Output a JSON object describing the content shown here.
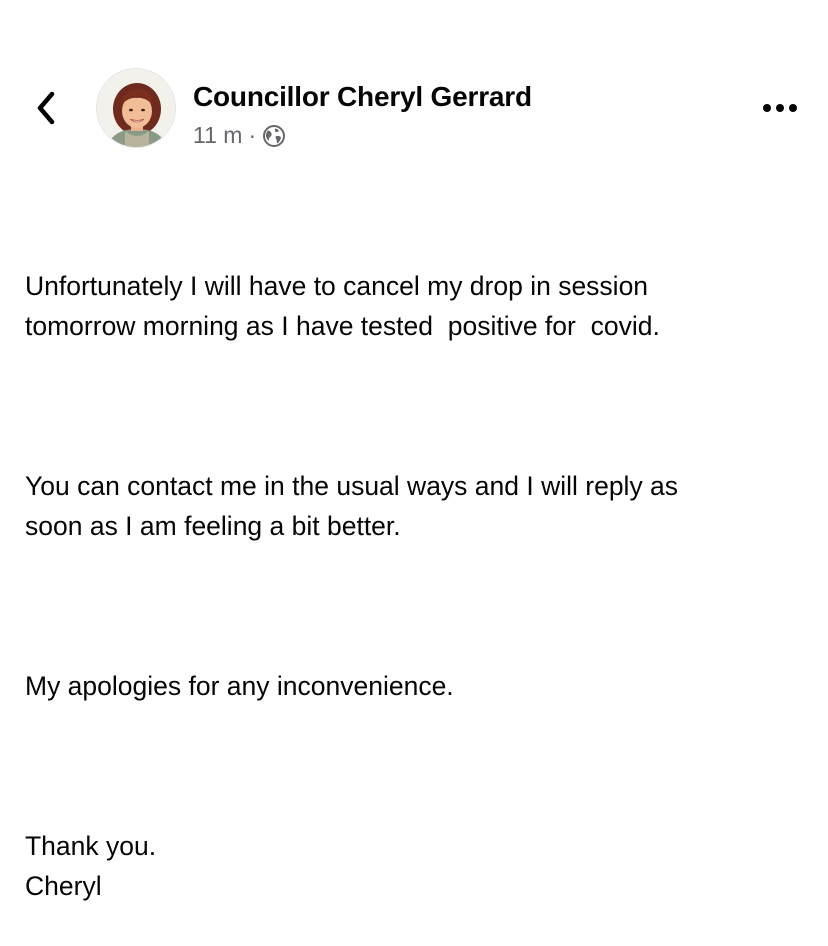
{
  "header": {
    "author_name": "Councillor Cheryl Gerrard",
    "timestamp": "11 m",
    "separator": "·",
    "audience_icon": "globe-icon",
    "back_icon": "chevron-left-icon",
    "more_icon": "more-horizontal-icon"
  },
  "post": {
    "paragraphs": [
      "Unfortunately I will have to cancel my drop in session\ntomorrow morning as I have tested  positive for  covid.",
      "You can contact me in the usual ways and I will reply as\nsoon as I am feeling a bit better.",
      "My apologies for any inconvenience.",
      "Thank you.\nCheryl"
    ]
  },
  "colors": {
    "text_primary": "#050505",
    "text_secondary": "#65676b",
    "background": "#ffffff"
  }
}
